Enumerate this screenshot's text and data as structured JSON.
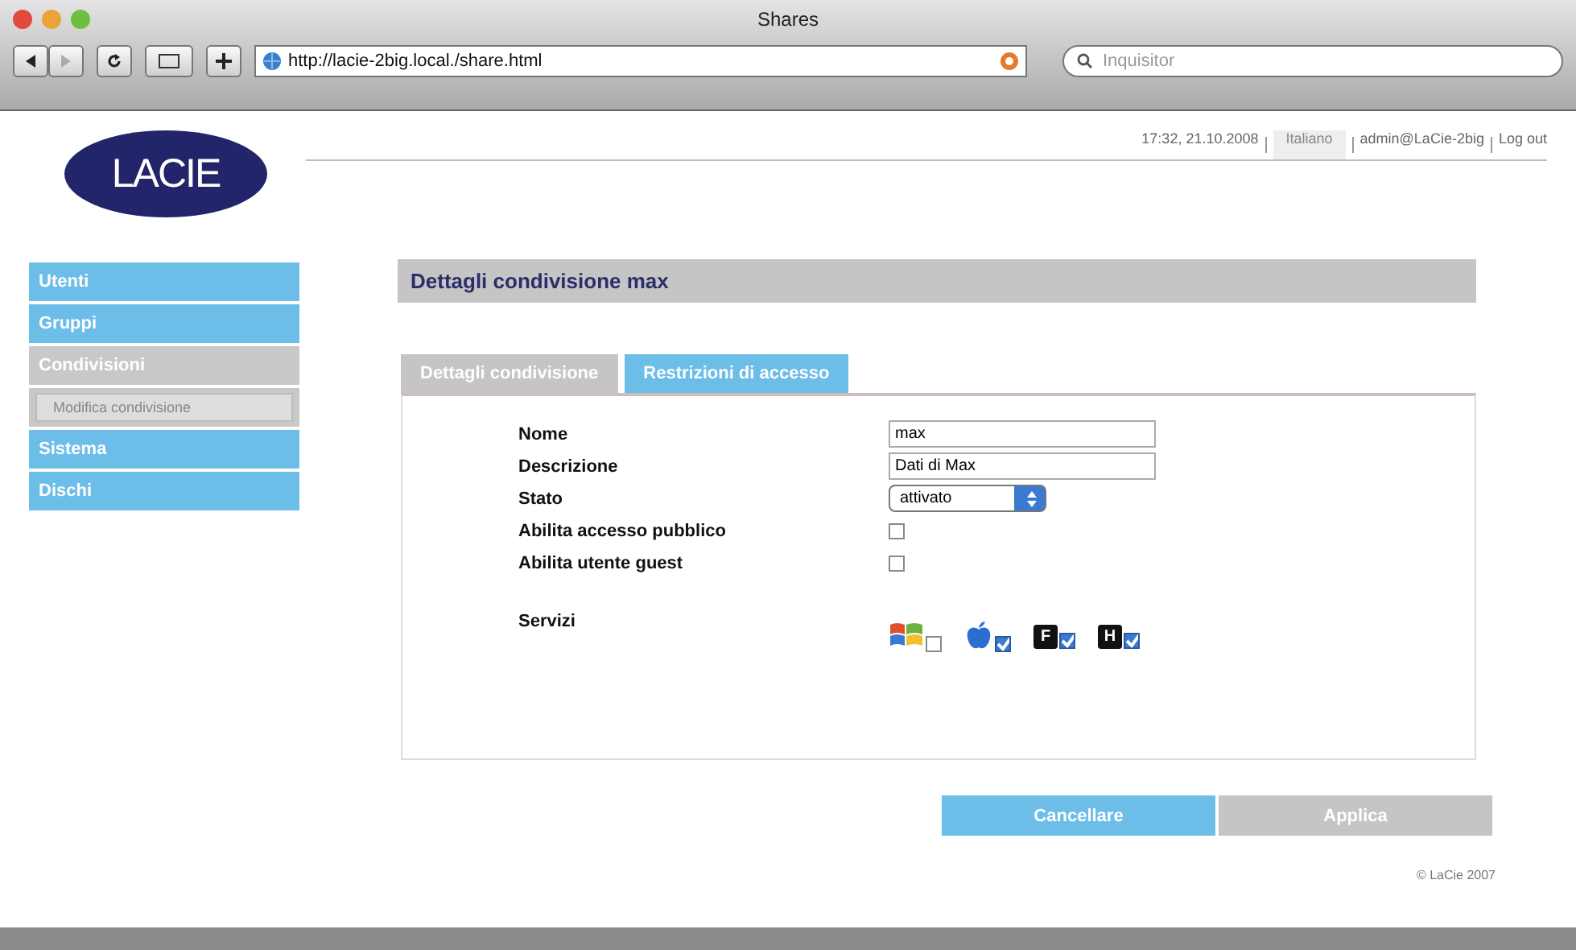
{
  "window": {
    "title": "Shares"
  },
  "toolbar": {
    "url": "http://lacie-2big.local./share.html",
    "search": {
      "placeholder": "Inquisitor"
    }
  },
  "logo": {
    "text": "LACIE"
  },
  "header": {
    "time": "17:32, 21.10.2008",
    "language": "Italiano",
    "user": "admin@LaCie-2big",
    "logout": "Log out"
  },
  "sidebar": {
    "items": [
      {
        "label": "Utenti",
        "selected": false
      },
      {
        "label": "Gruppi",
        "selected": false
      },
      {
        "label": "Condivisioni",
        "selected": true,
        "children": [
          {
            "label": "Modifica condivisione",
            "selected": false
          }
        ]
      },
      {
        "label": "Sistema",
        "selected": false
      },
      {
        "label": "Dischi",
        "selected": false
      }
    ]
  },
  "panel_title": "Dettagli condivisione max",
  "tabs": [
    {
      "label": "Dettagli condivisione",
      "selected": false
    },
    {
      "label": "Restrizioni di accesso",
      "selected": true
    }
  ],
  "form": [
    {
      "kind": "text",
      "label": "Nome",
      "value": "max"
    },
    {
      "kind": "text",
      "label": "Descrizione",
      "value": "Dati di Max"
    },
    {
      "kind": "select",
      "label": "Stato",
      "value": "attivato"
    },
    {
      "kind": "checkbox",
      "label": "Abilita accesso pubblico",
      "checked": false
    },
    {
      "kind": "checkbox",
      "label": "Abilita utente guest",
      "checked": false
    }
  ],
  "services": {
    "label": "Servizi",
    "items": [
      {
        "kind": "windows",
        "checked": false
      },
      {
        "kind": "apple",
        "checked": true
      },
      {
        "kind": "letter",
        "label": "F",
        "checked": true
      },
      {
        "kind": "letter",
        "label": "H",
        "checked": true
      }
    ]
  },
  "buttons": [
    {
      "label": "Cancellare",
      "kind": "primary"
    },
    {
      "label": "Applica",
      "kind": "secondary"
    }
  ],
  "footer": "© LaCie 2007"
}
